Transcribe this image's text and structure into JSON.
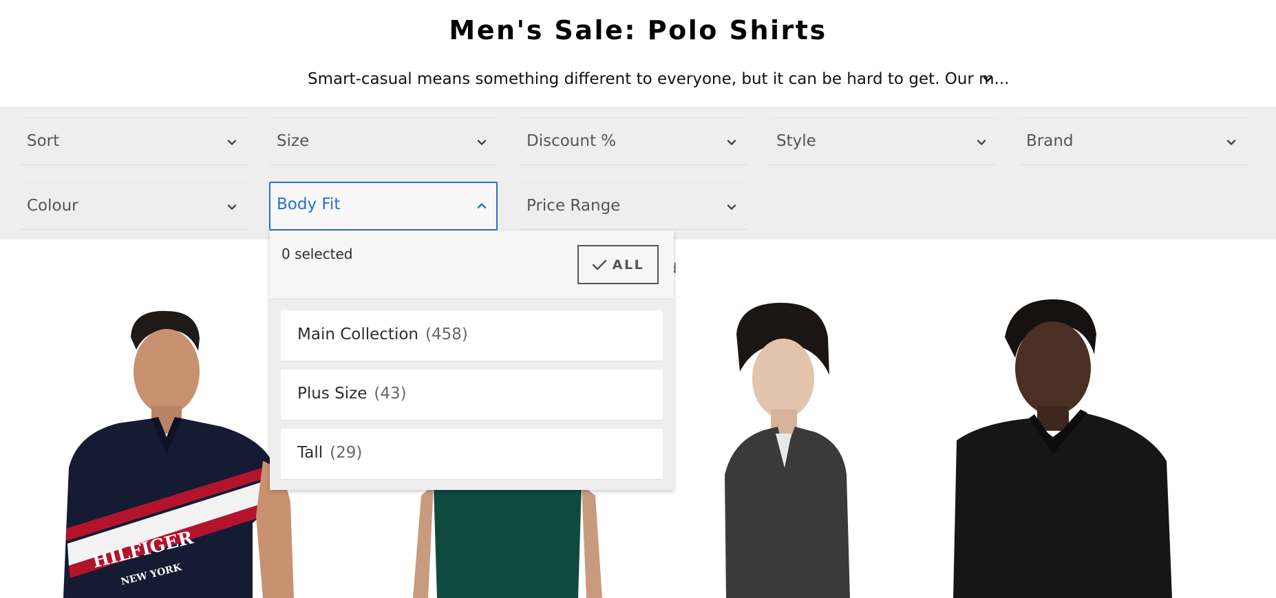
{
  "header": {
    "title": "Men's Sale: Polo Shirts",
    "description": "Smart-casual means something different to everyone, but it can be hard to get. Our m..."
  },
  "filters": [
    {
      "label": "Sort"
    },
    {
      "label": "Size"
    },
    {
      "label": "Discount %"
    },
    {
      "label": "Style"
    },
    {
      "label": "Brand"
    },
    {
      "label": "Colour"
    },
    {
      "label": "Body Fit",
      "expanded": true
    },
    {
      "label": "Price Range"
    }
  ],
  "dropdown": {
    "selected_count": "0 selected",
    "all_label": "ALL",
    "options": [
      {
        "label": "Main Collection",
        "count": "(458)"
      },
      {
        "label": "Plus Size",
        "count": "(43)"
      },
      {
        "label": "Tall",
        "count": "(29)"
      }
    ]
  },
  "results_partial_text": "nd",
  "colors": {
    "accent": "#2670d2",
    "filter_bg": "#eeeeee",
    "text": "#2d2d2d"
  },
  "icons": [
    "chevron-down-icon",
    "chevron-up-icon",
    "check-icon"
  ],
  "products": [
    {
      "image": "navy-hilfiger-polo",
      "print": "HILFIGER",
      "print_sub": "NEW YORK"
    },
    {
      "image": "green-polo"
    },
    {
      "image": "charcoal-knit-polo"
    },
    {
      "image": "black-polo"
    }
  ]
}
